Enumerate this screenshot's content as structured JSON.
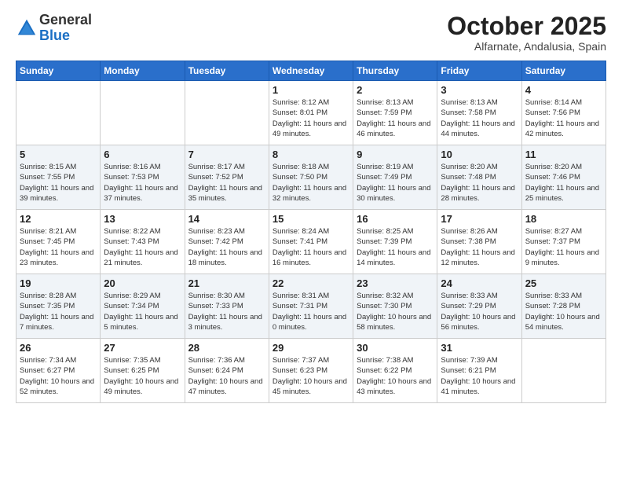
{
  "logo": {
    "general": "General",
    "blue": "Blue"
  },
  "header": {
    "month": "October 2025",
    "location": "Alfarnate, Andalusia, Spain"
  },
  "days_of_week": [
    "Sunday",
    "Monday",
    "Tuesday",
    "Wednesday",
    "Thursday",
    "Friday",
    "Saturday"
  ],
  "weeks": [
    [
      {
        "day": "",
        "sunrise": "",
        "sunset": "",
        "daylight": ""
      },
      {
        "day": "",
        "sunrise": "",
        "sunset": "",
        "daylight": ""
      },
      {
        "day": "",
        "sunrise": "",
        "sunset": "",
        "daylight": ""
      },
      {
        "day": "1",
        "sunrise": "Sunrise: 8:12 AM",
        "sunset": "Sunset: 8:01 PM",
        "daylight": "Daylight: 11 hours and 49 minutes."
      },
      {
        "day": "2",
        "sunrise": "Sunrise: 8:13 AM",
        "sunset": "Sunset: 7:59 PM",
        "daylight": "Daylight: 11 hours and 46 minutes."
      },
      {
        "day": "3",
        "sunrise": "Sunrise: 8:13 AM",
        "sunset": "Sunset: 7:58 PM",
        "daylight": "Daylight: 11 hours and 44 minutes."
      },
      {
        "day": "4",
        "sunrise": "Sunrise: 8:14 AM",
        "sunset": "Sunset: 7:56 PM",
        "daylight": "Daylight: 11 hours and 42 minutes."
      }
    ],
    [
      {
        "day": "5",
        "sunrise": "Sunrise: 8:15 AM",
        "sunset": "Sunset: 7:55 PM",
        "daylight": "Daylight: 11 hours and 39 minutes."
      },
      {
        "day": "6",
        "sunrise": "Sunrise: 8:16 AM",
        "sunset": "Sunset: 7:53 PM",
        "daylight": "Daylight: 11 hours and 37 minutes."
      },
      {
        "day": "7",
        "sunrise": "Sunrise: 8:17 AM",
        "sunset": "Sunset: 7:52 PM",
        "daylight": "Daylight: 11 hours and 35 minutes."
      },
      {
        "day": "8",
        "sunrise": "Sunrise: 8:18 AM",
        "sunset": "Sunset: 7:50 PM",
        "daylight": "Daylight: 11 hours and 32 minutes."
      },
      {
        "day": "9",
        "sunrise": "Sunrise: 8:19 AM",
        "sunset": "Sunset: 7:49 PM",
        "daylight": "Daylight: 11 hours and 30 minutes."
      },
      {
        "day": "10",
        "sunrise": "Sunrise: 8:20 AM",
        "sunset": "Sunset: 7:48 PM",
        "daylight": "Daylight: 11 hours and 28 minutes."
      },
      {
        "day": "11",
        "sunrise": "Sunrise: 8:20 AM",
        "sunset": "Sunset: 7:46 PM",
        "daylight": "Daylight: 11 hours and 25 minutes."
      }
    ],
    [
      {
        "day": "12",
        "sunrise": "Sunrise: 8:21 AM",
        "sunset": "Sunset: 7:45 PM",
        "daylight": "Daylight: 11 hours and 23 minutes."
      },
      {
        "day": "13",
        "sunrise": "Sunrise: 8:22 AM",
        "sunset": "Sunset: 7:43 PM",
        "daylight": "Daylight: 11 hours and 21 minutes."
      },
      {
        "day": "14",
        "sunrise": "Sunrise: 8:23 AM",
        "sunset": "Sunset: 7:42 PM",
        "daylight": "Daylight: 11 hours and 18 minutes."
      },
      {
        "day": "15",
        "sunrise": "Sunrise: 8:24 AM",
        "sunset": "Sunset: 7:41 PM",
        "daylight": "Daylight: 11 hours and 16 minutes."
      },
      {
        "day": "16",
        "sunrise": "Sunrise: 8:25 AM",
        "sunset": "Sunset: 7:39 PM",
        "daylight": "Daylight: 11 hours and 14 minutes."
      },
      {
        "day": "17",
        "sunrise": "Sunrise: 8:26 AM",
        "sunset": "Sunset: 7:38 PM",
        "daylight": "Daylight: 11 hours and 12 minutes."
      },
      {
        "day": "18",
        "sunrise": "Sunrise: 8:27 AM",
        "sunset": "Sunset: 7:37 PM",
        "daylight": "Daylight: 11 hours and 9 minutes."
      }
    ],
    [
      {
        "day": "19",
        "sunrise": "Sunrise: 8:28 AM",
        "sunset": "Sunset: 7:35 PM",
        "daylight": "Daylight: 11 hours and 7 minutes."
      },
      {
        "day": "20",
        "sunrise": "Sunrise: 8:29 AM",
        "sunset": "Sunset: 7:34 PM",
        "daylight": "Daylight: 11 hours and 5 minutes."
      },
      {
        "day": "21",
        "sunrise": "Sunrise: 8:30 AM",
        "sunset": "Sunset: 7:33 PM",
        "daylight": "Daylight: 11 hours and 3 minutes."
      },
      {
        "day": "22",
        "sunrise": "Sunrise: 8:31 AM",
        "sunset": "Sunset: 7:31 PM",
        "daylight": "Daylight: 11 hours and 0 minutes."
      },
      {
        "day": "23",
        "sunrise": "Sunrise: 8:32 AM",
        "sunset": "Sunset: 7:30 PM",
        "daylight": "Daylight: 10 hours and 58 minutes."
      },
      {
        "day": "24",
        "sunrise": "Sunrise: 8:33 AM",
        "sunset": "Sunset: 7:29 PM",
        "daylight": "Daylight: 10 hours and 56 minutes."
      },
      {
        "day": "25",
        "sunrise": "Sunrise: 8:33 AM",
        "sunset": "Sunset: 7:28 PM",
        "daylight": "Daylight: 10 hours and 54 minutes."
      }
    ],
    [
      {
        "day": "26",
        "sunrise": "Sunrise: 7:34 AM",
        "sunset": "Sunset: 6:27 PM",
        "daylight": "Daylight: 10 hours and 52 minutes."
      },
      {
        "day": "27",
        "sunrise": "Sunrise: 7:35 AM",
        "sunset": "Sunset: 6:25 PM",
        "daylight": "Daylight: 10 hours and 49 minutes."
      },
      {
        "day": "28",
        "sunrise": "Sunrise: 7:36 AM",
        "sunset": "Sunset: 6:24 PM",
        "daylight": "Daylight: 10 hours and 47 minutes."
      },
      {
        "day": "29",
        "sunrise": "Sunrise: 7:37 AM",
        "sunset": "Sunset: 6:23 PM",
        "daylight": "Daylight: 10 hours and 45 minutes."
      },
      {
        "day": "30",
        "sunrise": "Sunrise: 7:38 AM",
        "sunset": "Sunset: 6:22 PM",
        "daylight": "Daylight: 10 hours and 43 minutes."
      },
      {
        "day": "31",
        "sunrise": "Sunrise: 7:39 AM",
        "sunset": "Sunset: 6:21 PM",
        "daylight": "Daylight: 10 hours and 41 minutes."
      },
      {
        "day": "",
        "sunrise": "",
        "sunset": "",
        "daylight": ""
      }
    ]
  ]
}
